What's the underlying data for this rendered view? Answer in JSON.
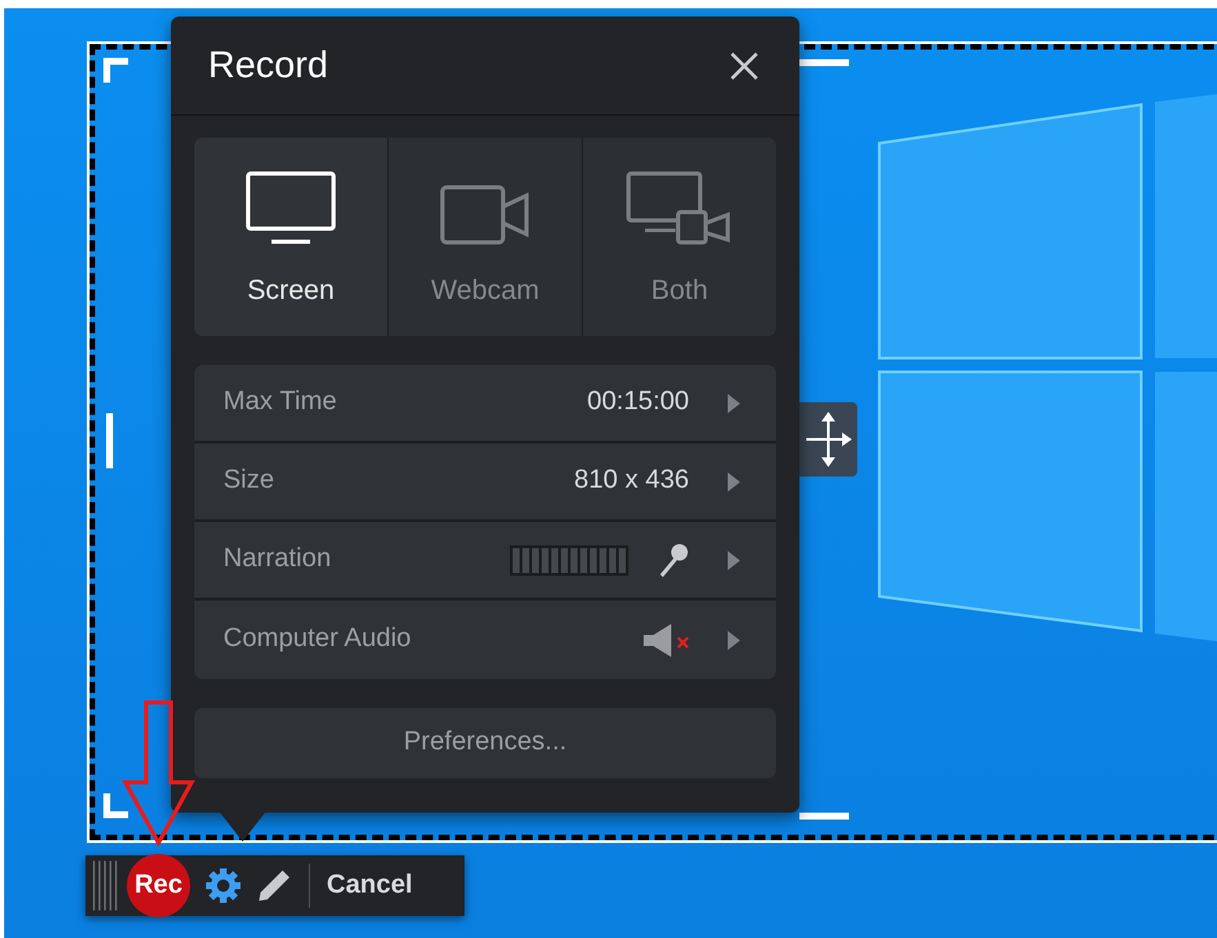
{
  "dialog": {
    "title": "Record"
  },
  "modes": [
    {
      "label": "Screen",
      "kind": "screen",
      "selected": true
    },
    {
      "label": "Webcam",
      "kind": "webcam",
      "selected": false
    },
    {
      "label": "Both",
      "kind": "both",
      "selected": false
    }
  ],
  "settings": [
    {
      "label": "Max Time",
      "kind": "text",
      "value": "00:15:00"
    },
    {
      "label": "Size",
      "kind": "text",
      "value": "810 x 436"
    },
    {
      "label": "Narration",
      "kind": "mic",
      "level": 0
    },
    {
      "label": "Computer Audio",
      "kind": "audio",
      "muted": true
    }
  ],
  "preferences_button": "Preferences...",
  "toolbar": {
    "rec": "Rec",
    "cancel": "Cancel"
  }
}
